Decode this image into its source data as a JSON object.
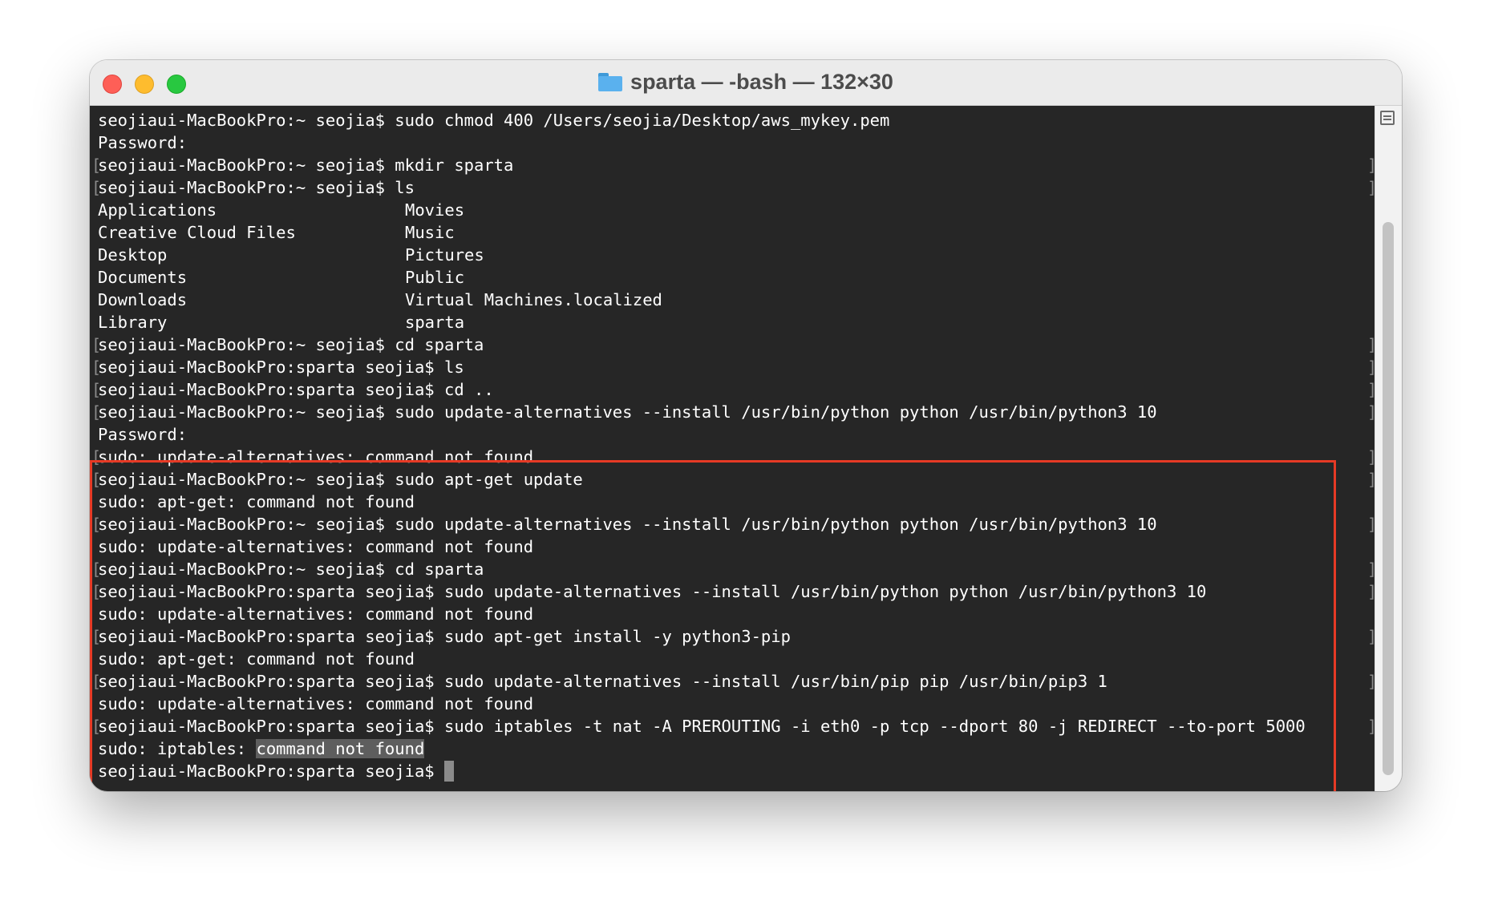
{
  "window": {
    "title": "sparta — -bash — 132×30"
  },
  "terminal": {
    "lines": [
      {
        "text": "seojiaui-MacBookPro:~ seojia$ sudo chmod 400 /Users/seojia/Desktop/aws_mykey.pem",
        "marked": false
      },
      {
        "text": "Password:",
        "marked": false
      },
      {
        "text": "seojiaui-MacBookPro:~ seojia$ mkdir sparta",
        "marked": true
      },
      {
        "text": "seojiaui-MacBookPro:~ seojia$ ls",
        "marked": true
      },
      {
        "text": "Applications",
        "text2": "Movies",
        "marked": false
      },
      {
        "text": "Creative Cloud Files",
        "text2": "Music",
        "marked": false
      },
      {
        "text": "Desktop",
        "text2": "Pictures",
        "marked": false
      },
      {
        "text": "Documents",
        "text2": "Public",
        "marked": false
      },
      {
        "text": "Downloads",
        "text2": "Virtual Machines.localized",
        "marked": false
      },
      {
        "text": "Library",
        "text2": "sparta",
        "marked": false
      },
      {
        "text": "seojiaui-MacBookPro:~ seojia$ cd sparta",
        "marked": true
      },
      {
        "text": "seojiaui-MacBookPro:sparta seojia$ ls",
        "marked": true
      },
      {
        "text": "seojiaui-MacBookPro:sparta seojia$ cd ..",
        "marked": true
      },
      {
        "text": "seojiaui-MacBookPro:~ seojia$ sudo update-alternatives --install /usr/bin/python python /usr/bin/python3 10",
        "marked": true
      },
      {
        "text": "Password:",
        "marked": false
      },
      {
        "text": "sudo: update-alternatives: command not found",
        "marked": true
      },
      {
        "text": "seojiaui-MacBookPro:~ seojia$ sudo apt-get update",
        "marked": true
      },
      {
        "text": "sudo: apt-get: command not found",
        "marked": false
      },
      {
        "text": "seojiaui-MacBookPro:~ seojia$ sudo update-alternatives --install /usr/bin/python python /usr/bin/python3 10",
        "marked": true
      },
      {
        "text": "sudo: update-alternatives: command not found",
        "marked": false
      },
      {
        "text": "seojiaui-MacBookPro:~ seojia$ cd sparta",
        "marked": true
      },
      {
        "text": "seojiaui-MacBookPro:sparta seojia$ sudo update-alternatives --install /usr/bin/python python /usr/bin/python3 10",
        "marked": true
      },
      {
        "text": "sudo: update-alternatives: command not found",
        "marked": false
      },
      {
        "text": "seojiaui-MacBookPro:sparta seojia$ sudo apt-get install -y python3-pip",
        "marked": true
      },
      {
        "text": "sudo: apt-get: command not found",
        "marked": false
      },
      {
        "text": "seojiaui-MacBookPro:sparta seojia$ sudo update-alternatives --install /usr/bin/pip pip /usr/bin/pip3 1",
        "marked": true
      },
      {
        "text": "sudo: update-alternatives: command not found",
        "marked": false
      },
      {
        "text": "seojiaui-MacBookPro:sparta seojia$ sudo iptables -t nat -A PREROUTING -i eth0 -p tcp --dport 80 -j REDIRECT --to-port 5000",
        "marked": true
      }
    ],
    "selection_line": {
      "prefix": "sudo: iptables: ",
      "selected": "command not found"
    },
    "prompt_line": "seojiaui-MacBookPro:sparta seojia$"
  },
  "colors": {
    "terminal_bg": "#262626",
    "highlight_box": "#e63a25"
  },
  "icons": {
    "title_icon": "folder-icon"
  }
}
